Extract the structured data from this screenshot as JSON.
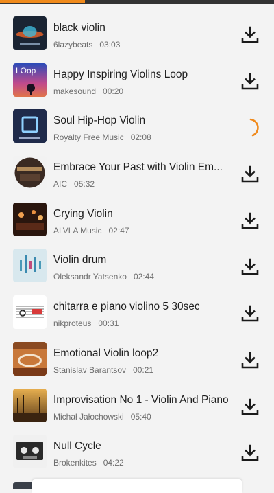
{
  "playback": {
    "progress_fraction": 0.31
  },
  "colors": {
    "accent": "#f08a1c",
    "title_text": "#1e1e1e",
    "meta_text": "#6d6d6d",
    "icon": "#1a1a1a"
  },
  "tracks": [
    {
      "title": "black violin",
      "artist": "6lazybeats",
      "duration": "03:03",
      "action_icon": "download-icon",
      "thumb_text": ""
    },
    {
      "title": "Happy Inspiring Violins Loop",
      "artist": "makesound",
      "duration": "00:20",
      "action_icon": "download-icon",
      "thumb_text": "LOop"
    },
    {
      "title": "Soul Hip-Hop Violin",
      "artist": "Royalty Free Music",
      "duration": "02:08",
      "action_icon": "loading-spinner-icon",
      "thumb_text": ""
    },
    {
      "title": "Embrace Your Past  with Violin   Em...",
      "artist": "AIC",
      "duration": "05:32",
      "action_icon": "download-icon",
      "thumb_text": ""
    },
    {
      "title": "Crying Violin",
      "artist": "ALVLA Music",
      "duration": "02:47",
      "action_icon": "download-icon",
      "thumb_text": ""
    },
    {
      "title": "Violin  drum",
      "artist": "Oleksandr Yatsenko",
      "duration": "02:44",
      "action_icon": "download-icon",
      "thumb_text": ""
    },
    {
      "title": "chitarra e piano violino 5 30sec",
      "artist": "nikproteus",
      "duration": "00:31",
      "action_icon": "download-icon",
      "thumb_text": ""
    },
    {
      "title": "Emotional Violin  loop2",
      "artist": "Stanislav Barantsov",
      "duration": "00:21",
      "action_icon": "download-icon",
      "thumb_text": ""
    },
    {
      "title": "Improvisation No 1 - Violin And Piano",
      "artist": "Michał Jałochowski",
      "duration": "05:40",
      "action_icon": "download-icon",
      "thumb_text": ""
    },
    {
      "title": "Null Cycle",
      "artist": "Brokenkites",
      "duration": "04:22",
      "action_icon": "download-icon",
      "thumb_text": ""
    }
  ]
}
